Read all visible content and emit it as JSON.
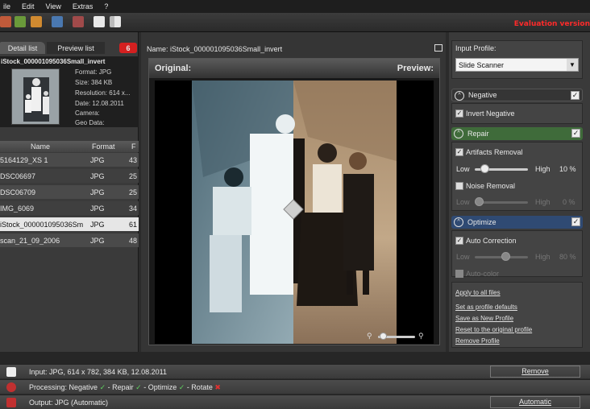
{
  "menu": [
    "ile",
    "Edit",
    "View",
    "Extras",
    "?"
  ],
  "evaluation": "Evaluation version",
  "left_panel": {
    "tabs": [
      "Detail list",
      "Preview list"
    ],
    "badge": "6",
    "selected_file": "iStock_000001095036Small_invert",
    "meta": [
      "Format: JPG",
      "Size: 384 KB",
      "Resolution: 614 x...",
      "Date: 12.08.2011",
      "Camera:",
      "Geo Data:"
    ],
    "columns": [
      "Name",
      "Format",
      "F"
    ],
    "files": [
      {
        "name": "5164129_XS 1",
        "format": "JPG",
        "size": "43"
      },
      {
        "name": "DSC06697",
        "format": "JPG",
        "size": "25"
      },
      {
        "name": "DSC06709",
        "format": "JPG",
        "size": "25"
      },
      {
        "name": "IMG_6069",
        "format": "JPG",
        "size": "34"
      },
      {
        "name": "iStock_000001095036Sm",
        "format": "JPG",
        "size": "61"
      },
      {
        "name": "scan_21_09_2006",
        "format": "JPG",
        "size": "48"
      }
    ]
  },
  "center": {
    "name_label": "Name: iStock_000001095036Small_invert",
    "original": "Original:",
    "preview": "Preview:"
  },
  "right_panel": {
    "input_profile_label": "Input Profile:",
    "input_profile_value": "Slide Scanner",
    "negative": {
      "title": "Negative",
      "invert_label": "Invert Negative"
    },
    "repair": {
      "title": "Repair",
      "artifacts_label": "Artifacts Removal",
      "low": "Low",
      "high": "High",
      "artifacts_value": "10 %",
      "noise_label": "Noise Removal",
      "noise_value": "0 %",
      "artifacts_level": 0.1,
      "noise_level": 0
    },
    "optimize": {
      "title": "Optimize",
      "auto_correction_label": "Auto Correction",
      "auto_value": "80 %",
      "auto_color_label": "Auto-color",
      "auto_level": 0.8
    },
    "links": [
      "Apply to all files",
      "Set as profile defaults",
      "Save as New Profile",
      "Reset to the original profile",
      "Remove Profile"
    ]
  },
  "bottom": {
    "input_text": "Input: JPG, 614 x 782, 384 KB, 12.08.2011",
    "input_button": "Remove",
    "processing_parts": [
      "Processing: Negative",
      "- Repair",
      "- Optimize",
      "- Rotate"
    ],
    "output_text": "Output: JPG (Automatic)",
    "output_button": "Automatic"
  },
  "colors": {
    "repair_header": "#3f6b3a",
    "negative_header": "#3a3a3a",
    "optimize_header": "#2f4a73",
    "evaluation": "#ff2a2a",
    "badge": "#d42020"
  }
}
